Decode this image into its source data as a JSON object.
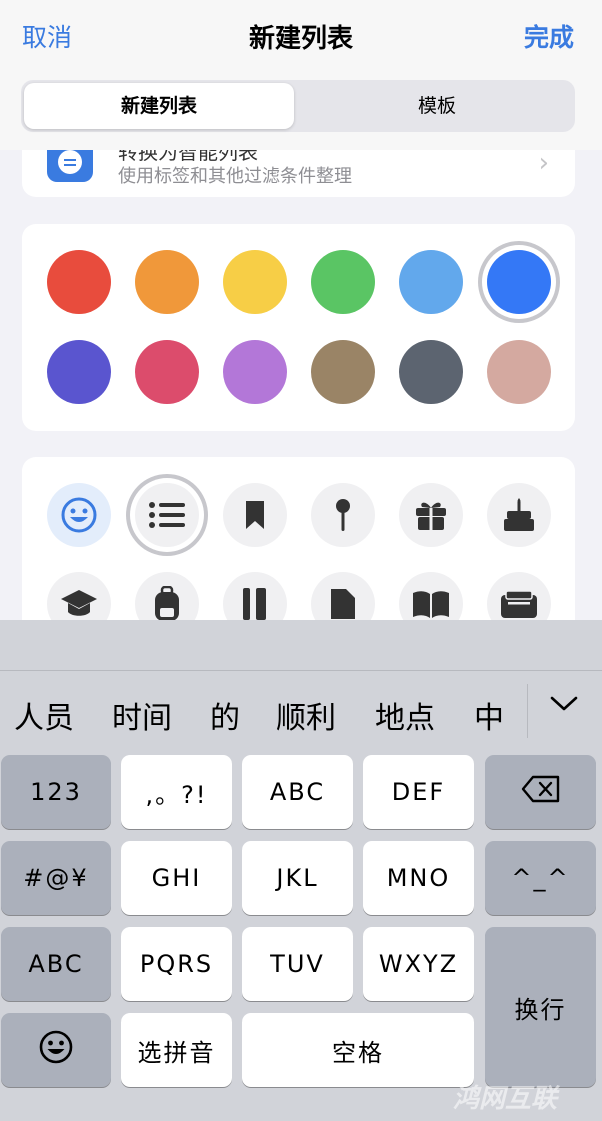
{
  "nav": {
    "cancel": "取消",
    "title": "新建列表",
    "done": "完成"
  },
  "segments": {
    "active": "新建列表",
    "inactive": "模板"
  },
  "template_card": {
    "title": "转换为智能列表",
    "subtitle": "使用标签和其他过滤条件整理"
  },
  "colors": {
    "row1": [
      "#e84c3d",
      "#f0983a",
      "#f7ce46",
      "#5ac564",
      "#62a8ec",
      "#3478f6"
    ],
    "row2": [
      "#5a55cf",
      "#dc4c6c",
      "#b377d8",
      "#9a8466",
      "#5c6470",
      "#d4a9a0"
    ],
    "selected": "#3478f6"
  },
  "icons": {
    "row1": [
      "smiley-icon",
      "list-icon",
      "bookmark-icon",
      "pin-icon",
      "gift-icon",
      "birthday-cake-icon"
    ],
    "row2": [
      "graduation-cap-icon",
      "backpack-icon",
      "ruler-pencil-icon",
      "document-icon",
      "book-icon",
      "wallet-icon"
    ],
    "selected": "list-icon"
  },
  "keyboard": {
    "candidates": [
      "人员",
      "时间",
      "的",
      "顺利",
      "地点",
      "中"
    ],
    "keys": {
      "num": "123",
      "punct": ",。?!",
      "abc": "ABC",
      "def": "DEF",
      "symbols": "#@¥",
      "ghi": "GHI",
      "jkl": "JKL",
      "mno": "MNO",
      "kaomoji": "^_^",
      "abc_switch": "ABC",
      "pqrs": "PQRS",
      "tuv": "TUV",
      "wxyz": "WXYZ",
      "return": "换行",
      "pinyin": "选拼音",
      "space": "空格"
    }
  },
  "watermark": "鸿网互联"
}
